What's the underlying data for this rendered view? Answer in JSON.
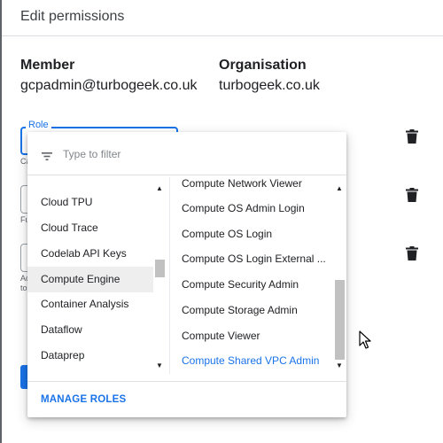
{
  "header": {
    "title": "Edit permissions"
  },
  "member": {
    "label": "Member",
    "value": "gcpadmin@turbogeek.co.uk"
  },
  "organisation": {
    "label": "Organisation",
    "value": "turbogeek.co.uk"
  },
  "role_field": {
    "label": "Role"
  },
  "hints": {
    "h1": "Ca",
    "h2": "Fu",
    "h3a": "Ac",
    "h3b": "to"
  },
  "filter": {
    "placeholder": "Type to filter",
    "value": ""
  },
  "services": [
    {
      "label": "Cloud TPU"
    },
    {
      "label": "Cloud Trace"
    },
    {
      "label": "Codelab API Keys"
    },
    {
      "label": "Compute Engine",
      "highlighted": true
    },
    {
      "label": "Container Analysis"
    },
    {
      "label": "Dataflow"
    },
    {
      "label": "Dataprep"
    }
  ],
  "roles": [
    {
      "label": "Compute Network Viewer"
    },
    {
      "label": "Compute OS Admin Login"
    },
    {
      "label": "Compute OS Login"
    },
    {
      "label": "Compute OS Login External ..."
    },
    {
      "label": "Compute Security Admin"
    },
    {
      "label": "Compute Storage Admin"
    },
    {
      "label": "Compute Viewer"
    },
    {
      "label": "Compute Shared VPC Admin",
      "selected": true
    }
  ],
  "footer": {
    "manage_roles": "MANAGE ROLES"
  },
  "icons": {
    "trash": "trash-icon",
    "filter": "filter-icon",
    "scroll_up": "scroll-up-arrow-icon",
    "scroll_down": "scroll-down-arrow-icon",
    "cursor": "mouse-cursor-icon"
  },
  "colors": {
    "accent": "#1a73e8",
    "highlight": "#eeeeee",
    "scroll_thumb": "#c1c1c1"
  }
}
